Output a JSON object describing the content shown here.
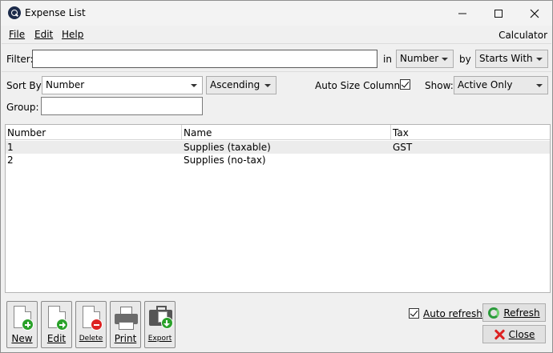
{
  "window": {
    "title": "Expense List"
  },
  "menu": {
    "file": "File",
    "edit": "Edit",
    "help": "Help",
    "calculator": "Calculator"
  },
  "filter": {
    "label": "Filter:",
    "value": "",
    "in_label": "in",
    "in_value": "Number",
    "by_label": "by",
    "by_value": "Starts With"
  },
  "sort": {
    "label": "Sort By:",
    "field": "Number",
    "order": "Ascending",
    "auto_size_label": "Auto Size Columns",
    "auto_size_checked": true,
    "show_label": "Show:",
    "show_value": "Active Only"
  },
  "group": {
    "label": "Group:",
    "value": ""
  },
  "table": {
    "columns": [
      "Number",
      "Name",
      "Tax"
    ],
    "rows": [
      {
        "number": "1",
        "name": "Supplies (taxable)",
        "tax": "GST",
        "selected": true
      },
      {
        "number": "2",
        "name": "Supplies (no-tax)",
        "tax": "",
        "selected": false
      }
    ]
  },
  "toolbar": {
    "new": "New",
    "edit": "Edit",
    "delete": "Delete",
    "print": "Print",
    "export": "Export"
  },
  "footer": {
    "auto_refresh_label": "Auto refresh",
    "auto_refresh_checked": true,
    "refresh": "Refresh",
    "close": "Close"
  }
}
